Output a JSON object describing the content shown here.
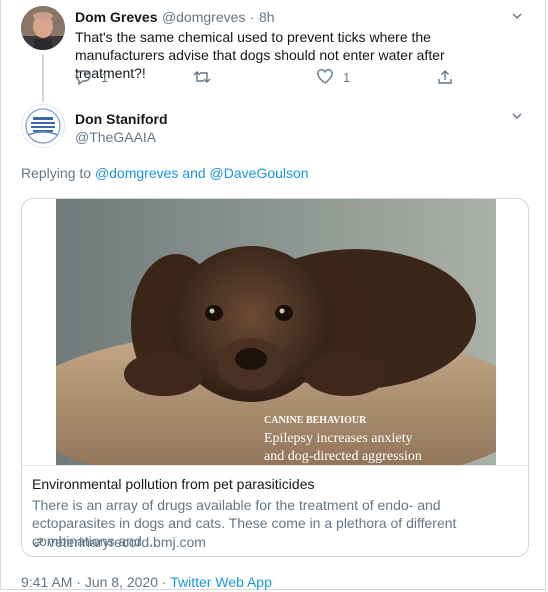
{
  "tweet1": {
    "name": "Dom Greves",
    "handle": "@domgreves",
    "sep": "·",
    "time": "8h",
    "text": "That's the same chemical used to prevent ticks where the manufacturers advise that dogs should not enter water after treatment?!",
    "reply_count": "1",
    "like_count": "1"
  },
  "tweet2": {
    "name": "Don Staniford",
    "handle": "@TheGAAIA",
    "replying_prefix": "Replying to",
    "mention1": "@domgreves",
    "and": "and",
    "mention2": "@DaveGoulson",
    "card": {
      "image_kicker": "CANINE BEHAVIOUR",
      "image_headline_1": "Epilepsy increases anxiety",
      "image_headline_2": "and dog-directed aggression",
      "title": "Environmental pollution from pet parasiticides",
      "description": "There is an array of drugs available for the treatment of endo- and ectoparasites in dogs and cats. These come in a plethora of different combinations and ...",
      "domain": "veterinaryrecord.bmj.com"
    },
    "time": "9:41 AM",
    "dot": "·",
    "date": "Jun 8, 2020",
    "dot2": "·",
    "source": "Twitter Web App"
  },
  "colors": {
    "link": "#1b95e0",
    "muted": "#657786",
    "text": "#14171a",
    "border": "#ccd6dd"
  },
  "icons": [
    "reply-icon",
    "retweet-icon",
    "like-icon",
    "share-icon",
    "chevron-down-icon",
    "link-icon"
  ]
}
